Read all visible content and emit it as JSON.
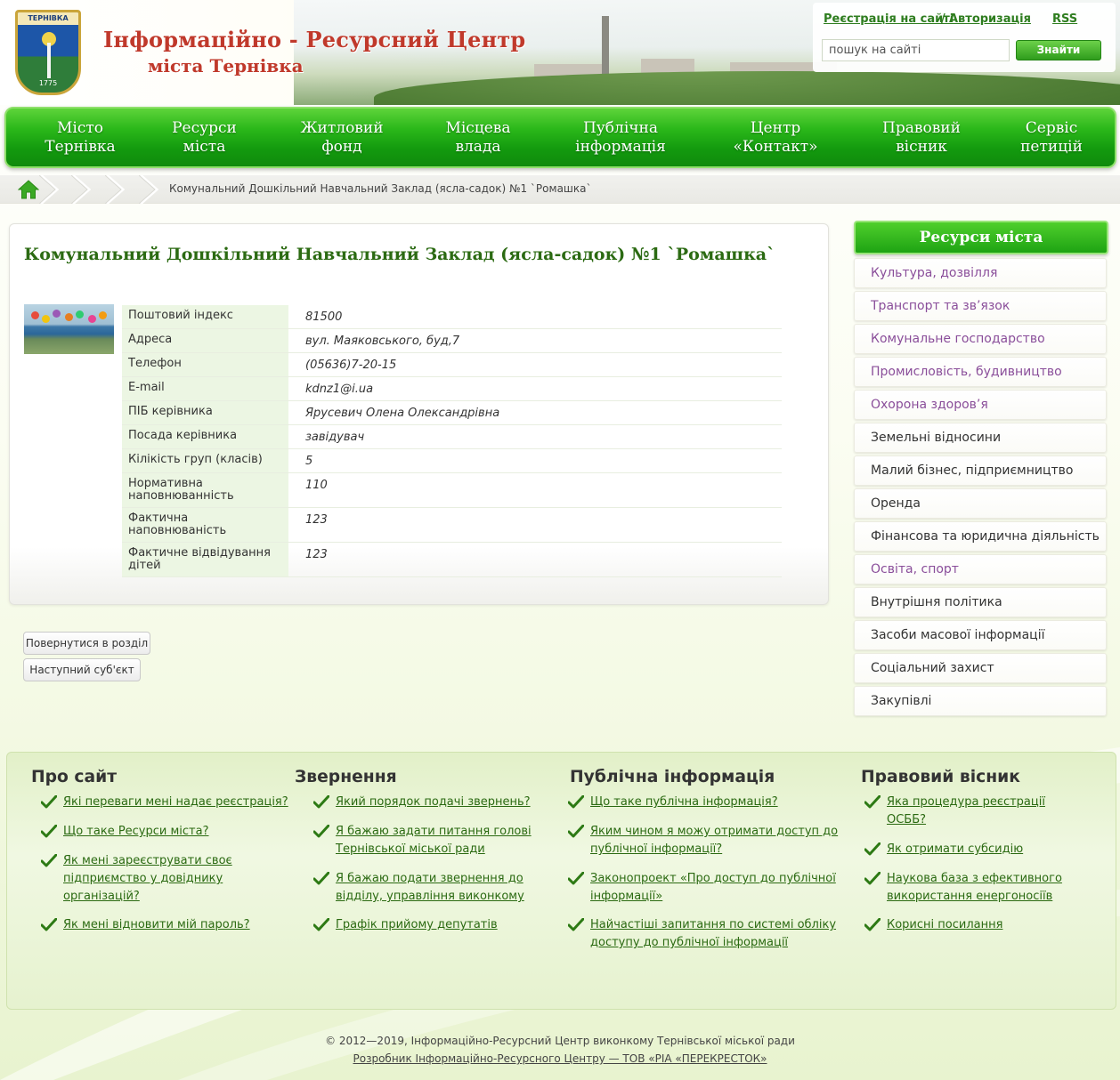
{
  "header": {
    "logo_name": "ТЕРНІВКА",
    "logo_year": "1775",
    "title": "Інформаційно - Ресурсний Центр",
    "subtitle": "міста Тернівка",
    "register_link": "Реєстрація на сайті",
    "separator": "/",
    "login_link": "Авторизація",
    "rss_link": "RSS",
    "search_placeholder": "пошук на сайті",
    "search_button": "Знайти"
  },
  "nav": {
    "items": [
      {
        "line1": "Місто",
        "line2": "Тернівка"
      },
      {
        "line1": "Ресурси",
        "line2": "міста"
      },
      {
        "line1": "Житловий",
        "line2": "фонд"
      },
      {
        "line1": "Місцева",
        "line2": "влада"
      },
      {
        "line1": "Публічна",
        "line2": "інформація"
      },
      {
        "line1": "Центр",
        "line2": "«Контакт»"
      },
      {
        "line1": "Правовий",
        "line2": "вісник"
      },
      {
        "line1": "Сервіс",
        "line2": "петицій"
      }
    ]
  },
  "breadcrumb": {
    "current": "Комунальний Дошкільний Навчальний Заклад (ясла-садок) №1 `Ромашка`"
  },
  "main": {
    "title": "Комунальний Дошкільний Навчальний Заклад (ясла-садок) №1 `Ромашка`",
    "fields": [
      {
        "key": "Поштовий індекс",
        "value": "81500"
      },
      {
        "key": "Адреса",
        "value": "вул. Маяковського, буд,7"
      },
      {
        "key": "Телефон",
        "value": "(05636)7-20-15"
      },
      {
        "key": "E-mail",
        "value": "kdnz1@i.ua"
      },
      {
        "key": "ПІБ керівника",
        "value": "Ярусевич Олена Олександрівна"
      },
      {
        "key": "Посада керівника",
        "value": "завідувач"
      },
      {
        "key": "Кілікість груп (класів)",
        "value": "5"
      },
      {
        "key": "Нормативна наповнюванність",
        "value": "110"
      },
      {
        "key": "Фактична наповнюваність",
        "value": "123"
      },
      {
        "key": "Фактичне відвідування дітей",
        "value": "123"
      }
    ],
    "back_button": "Повернутися в розділ",
    "next_button": "Наступний суб'єкт"
  },
  "sidebar": {
    "title": "Ресурси міста",
    "items": [
      {
        "label": "Культура, дозвілля",
        "visited": true
      },
      {
        "label": "Транспорт та зв’язок",
        "visited": true
      },
      {
        "label": "Комунальне господарство",
        "visited": true
      },
      {
        "label": "Промисловість, будивництво",
        "visited": true
      },
      {
        "label": "Охорона здоров’я",
        "visited": true
      },
      {
        "label": "Земельні відносини",
        "visited": false
      },
      {
        "label": "Малий бізнес, підприємництво",
        "visited": false
      },
      {
        "label": "Оренда",
        "visited": false
      },
      {
        "label": "Фінансова та юридична діяльність",
        "visited": false
      },
      {
        "label": "Освіта, спорт",
        "visited": true
      },
      {
        "label": "Внутрішня політика",
        "visited": false
      },
      {
        "label": "Засоби масової інформації",
        "visited": false
      },
      {
        "label": "Соціальний захист",
        "visited": false
      },
      {
        "label": "Закупівлі",
        "visited": false
      }
    ]
  },
  "footer": {
    "columns": [
      {
        "title": "Про сайт",
        "links": [
          [
            "Які переваги мені надає реєстрація?"
          ],
          [
            "Що таке Ресурси міста?"
          ],
          [
            "Як мені зареєструвати своє",
            "підприємство у довіднику",
            "організацій?"
          ],
          [
            "Як мені відновити мій пароль?"
          ]
        ]
      },
      {
        "title": "Звернення",
        "links": [
          [
            "Який порядок подачі звернень?"
          ],
          [
            "Я бажаю задати питання голові",
            "Тернівської міської ради"
          ],
          [
            "Я бажаю подати звернення до",
            "відділу, управління виконкому"
          ],
          [
            "Графік прийому депутатів"
          ]
        ]
      },
      {
        "title": "Публічна інформація",
        "links": [
          [
            "Що таке публічна інформація?"
          ],
          [
            "Яким чином я можу отримати доступ до",
            "публічної інформації?"
          ],
          [
            "Законопроект «Про доступ до публічної",
            "інформації»"
          ],
          [
            "Найчастіші запитання по системі обліку",
            "доступу до публічної інформації"
          ]
        ]
      },
      {
        "title": "Правовий вісник",
        "links": [
          [
            "Яка процедура реєстрації",
            "ОСББ?"
          ],
          [
            "Як отримати субсидію"
          ],
          [
            "Наукова база з ефективного",
            "використання енергоносіїв"
          ],
          [
            "Корисні посилання"
          ]
        ]
      }
    ],
    "copyright": "© 2012—2019, Інформаційно-Ресурсний Центр виконкому Тернівської міської ради",
    "developer": "Розробник Інформаційно-Ресурсного Центру — ТОВ «РІА «ПЕРЕКРЕСТОК»"
  },
  "colors": {
    "brand_green": "#1ea313",
    "title_red": "#c0392b",
    "link_green": "#2b6a12",
    "visited_purple": "#8a4e9a"
  }
}
